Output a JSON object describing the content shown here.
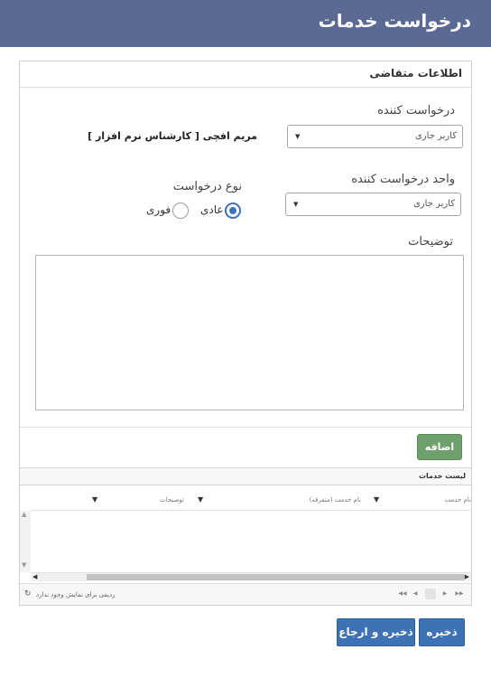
{
  "header": {
    "title": "درخواست  خدمات"
  },
  "panel": {
    "heading": "اطلاعات متقاضی"
  },
  "form": {
    "requester": {
      "label": "درخواست کننده",
      "value": "کاربر جاری",
      "name": "مریم افچی [ کارشناس نرم افزار ]"
    },
    "requester_unit": {
      "label": "واحد درخواست کننده",
      "value": "کاربر جاری"
    },
    "request_type": {
      "label": "نوع درخواست",
      "options": [
        {
          "label": "عادی",
          "checked": true
        },
        {
          "label": "فوری",
          "checked": false
        }
      ]
    },
    "description": {
      "label": "توضیحات",
      "value": ""
    },
    "add_label": "اضافه"
  },
  "grid": {
    "title": "لیست خدمات",
    "columns": [
      {
        "title": "نام خدمت"
      },
      {
        "title": "نام خدمت (متفرقه)"
      },
      {
        "title": "توضیحات"
      }
    ],
    "status": "ردیفی برای نمایش وجود ندارد",
    "current_page": ""
  },
  "actions": {
    "save_label": "ذخیره",
    "save_return_label": "ذخیره و ارجاع"
  },
  "colors": {
    "header": "#5a6a93",
    "primary_button": "#3d72b4",
    "add_button": "#6f9f6c",
    "radio_accent": "#3b73b9"
  },
  "icons": {
    "dropdown": "caret-down-icon",
    "filter": "filter-icon",
    "refresh": "refresh-icon"
  }
}
